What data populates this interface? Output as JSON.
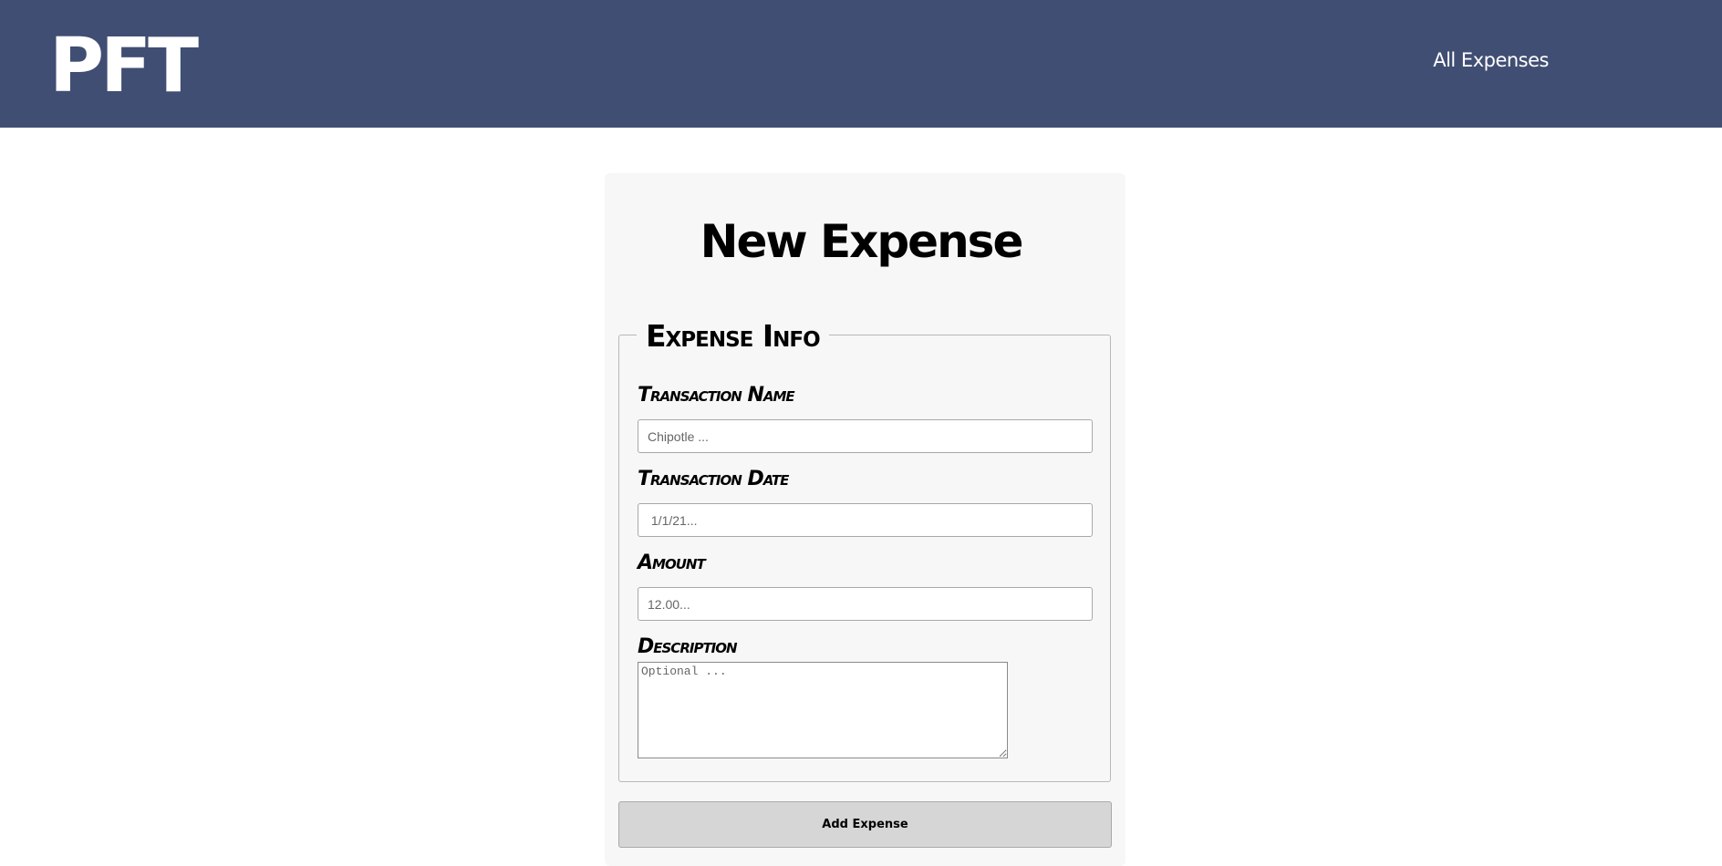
{
  "header": {
    "logo": "PFT",
    "nav_link": "All Expenses",
    "background_color": "#414e73"
  },
  "form": {
    "title": "New Expense",
    "fieldset_legend": "Expense Info",
    "fields": {
      "transaction_name": {
        "label": "Transaction Name",
        "placeholder": "Chipotle ...",
        "value": ""
      },
      "transaction_date": {
        "label": "Transaction Date",
        "placeholder": " 1/1/21...",
        "value": ""
      },
      "amount": {
        "label": "Amount",
        "placeholder": "12.00...",
        "value": ""
      },
      "description": {
        "label": "Description",
        "placeholder": "Optional ...",
        "value": ""
      }
    },
    "submit_label": "Add Expense"
  }
}
